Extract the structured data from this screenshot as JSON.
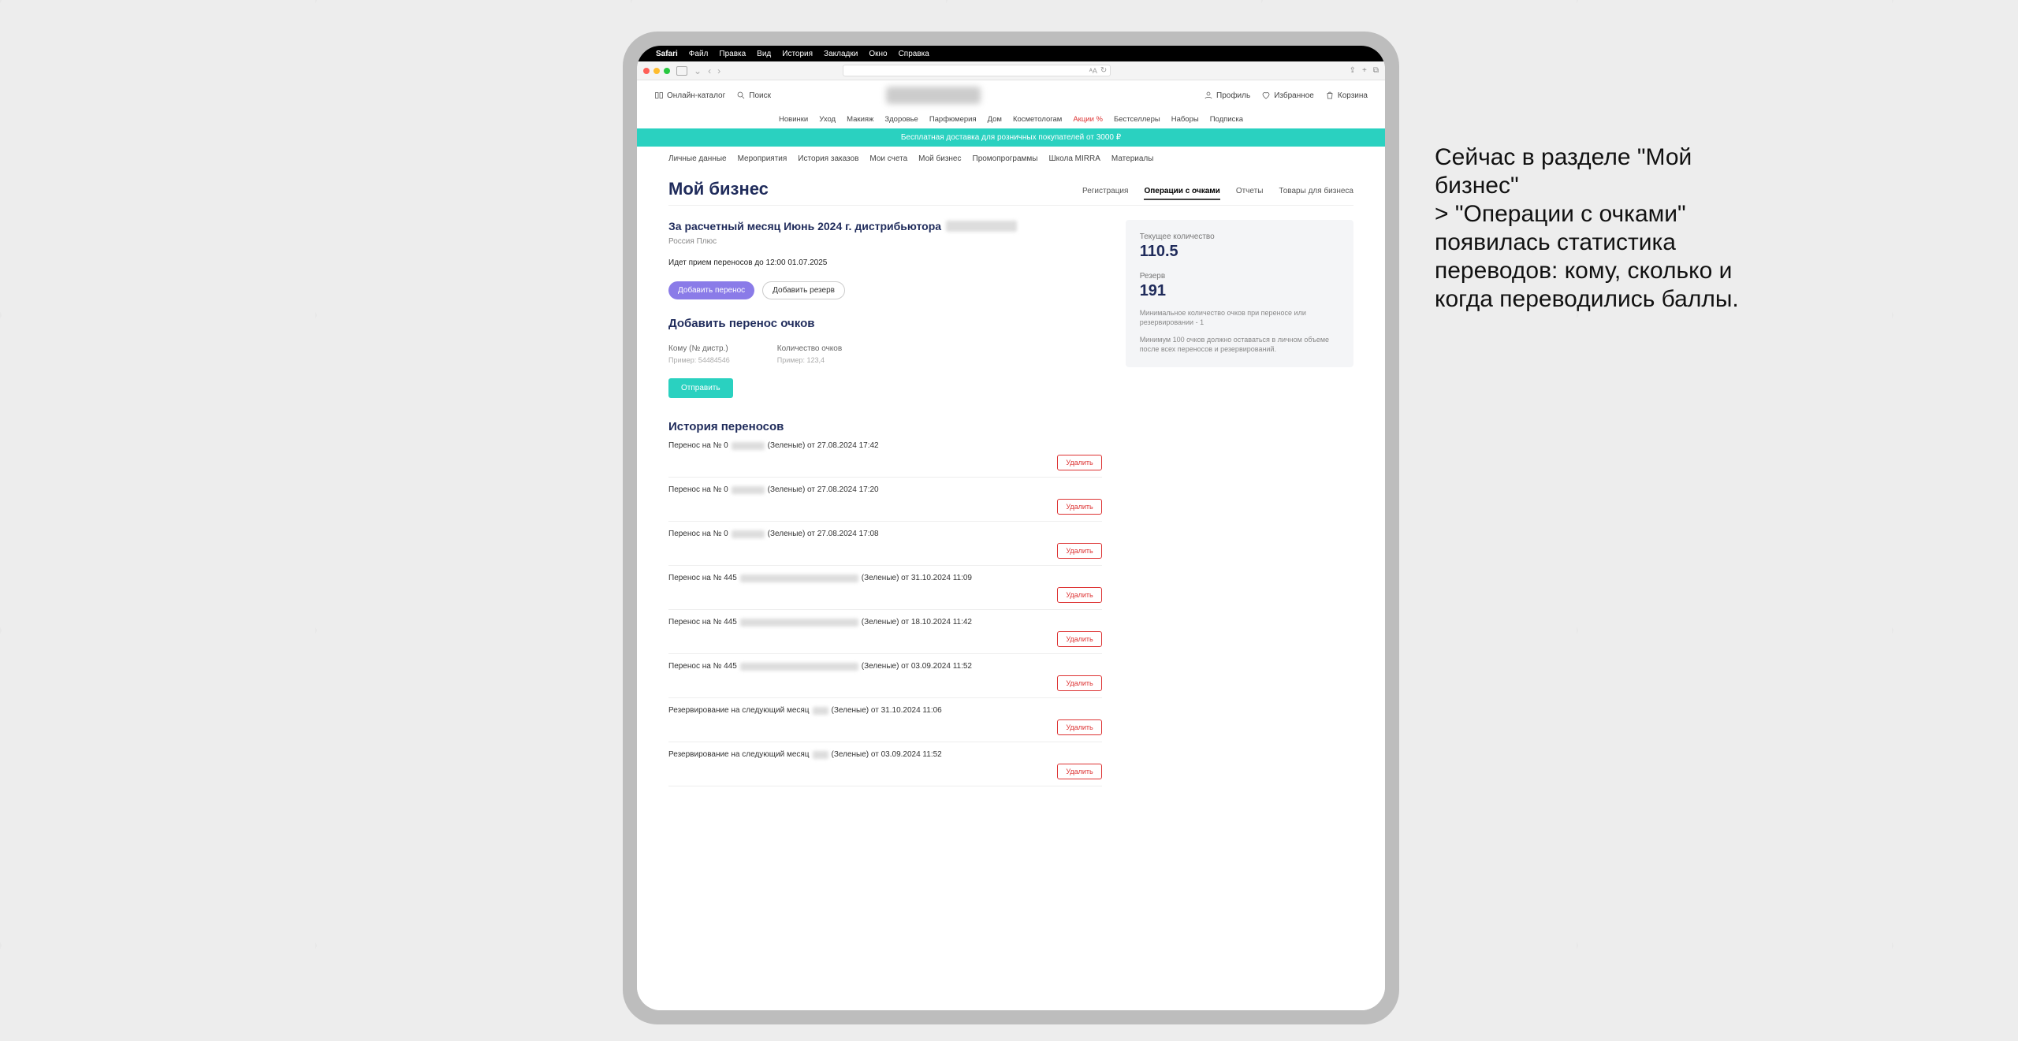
{
  "mac_menu": {
    "apple": "",
    "items": [
      "Safari",
      "Файл",
      "Правка",
      "Вид",
      "История",
      "Закладки",
      "Окно",
      "Справка"
    ]
  },
  "browser": {
    "url_hint": "",
    "share": "⇪",
    "plus": "+",
    "tabs": "⧉"
  },
  "topnav": {
    "catalog": "Онлайн-каталог",
    "search": "Поиск",
    "profile": "Профиль",
    "fav": "Избранное",
    "cart": "Корзина"
  },
  "catnav": [
    "Новинки",
    "Уход",
    "Макияж",
    "Здоровье",
    "Парфюмерия",
    "Дом",
    "Косметологам"
  ],
  "catnav_red": "Акции %",
  "catnav_tail": [
    "Бестселлеры",
    "Наборы",
    "Подписка"
  ],
  "banner": "Бесплатная доставка для розничных покупателей от 3000 ₽",
  "subnav": [
    "Личные данные",
    "Мероприятия",
    "История заказов",
    "Мои счета",
    "Мой бизнес",
    "Промопрограммы",
    "Школа MIRRA",
    "Материалы"
  ],
  "page_title": "Мой бизнес",
  "tabs": {
    "items": [
      "Регистрация",
      "Операции с очками",
      "Отчеты",
      "Товары для бизнеса"
    ],
    "active_index": 1
  },
  "main": {
    "header_line": "За расчетный месяц Июнь 2024 г. дистрибьютора",
    "sub": "Россия Плюс",
    "info": "Идет прием переносов до 12:00 01.07.2025",
    "btn_add_transfer": "Добавить перенос",
    "btn_add_reserve": "Добавить резерв",
    "form_title": "Добавить перенос очков",
    "f_to_label": "Кому (№ дистр.)",
    "f_to_hint": "Пример: 54484546",
    "f_amount_label": "Количество очков",
    "f_amount_hint": "Пример: 123,4",
    "btn_send": "Отправить",
    "history_title": "История переносов",
    "delete": "Удалить"
  },
  "sidebox": {
    "cur_label": "Текущее количество",
    "cur_value": "110.5",
    "res_label": "Резерв",
    "res_value": "191",
    "note1": "Минимальное количество очков при переносе или резервировании - 1",
    "note2": "Минимум 100 очков должно оставаться в личном объеме после всех переносов и резервирований."
  },
  "history": [
    {
      "prefix": "Перенос на № 0",
      "redact_w": 42,
      "suffix": "(Зеленые) от 27.08.2024 17:42"
    },
    {
      "prefix": "Перенос на № 0",
      "redact_w": 42,
      "suffix": "(Зеленые) от 27.08.2024 17:20"
    },
    {
      "prefix": "Перенос на № 0",
      "redact_w": 42,
      "suffix": "(Зеленые) от 27.08.2024 17:08"
    },
    {
      "prefix": "Перенос на № 445",
      "redact_w": 150,
      "suffix": "(Зеленые) от 31.10.2024 11:09"
    },
    {
      "prefix": "Перенос на № 445",
      "redact_w": 150,
      "suffix": "(Зеленые) от 18.10.2024 11:42"
    },
    {
      "prefix": "Перенос на № 445",
      "redact_w": 150,
      "suffix": "(Зеленые) от 03.09.2024 11:52"
    },
    {
      "prefix": "Резервирование на следующий месяц",
      "redact_w": 20,
      "suffix": "(Зеленые) от 31.10.2024 11:06"
    },
    {
      "prefix": "Резервирование на следующий месяц",
      "redact_w": 20,
      "suffix": "(Зеленые) от 03.09.2024 11:52"
    }
  ],
  "caption": "Сейчас в разделе \"Мой бизнес\"\n> \"Операции с очками\" появилась статистика переводов: кому, сколько и когда переводились баллы."
}
